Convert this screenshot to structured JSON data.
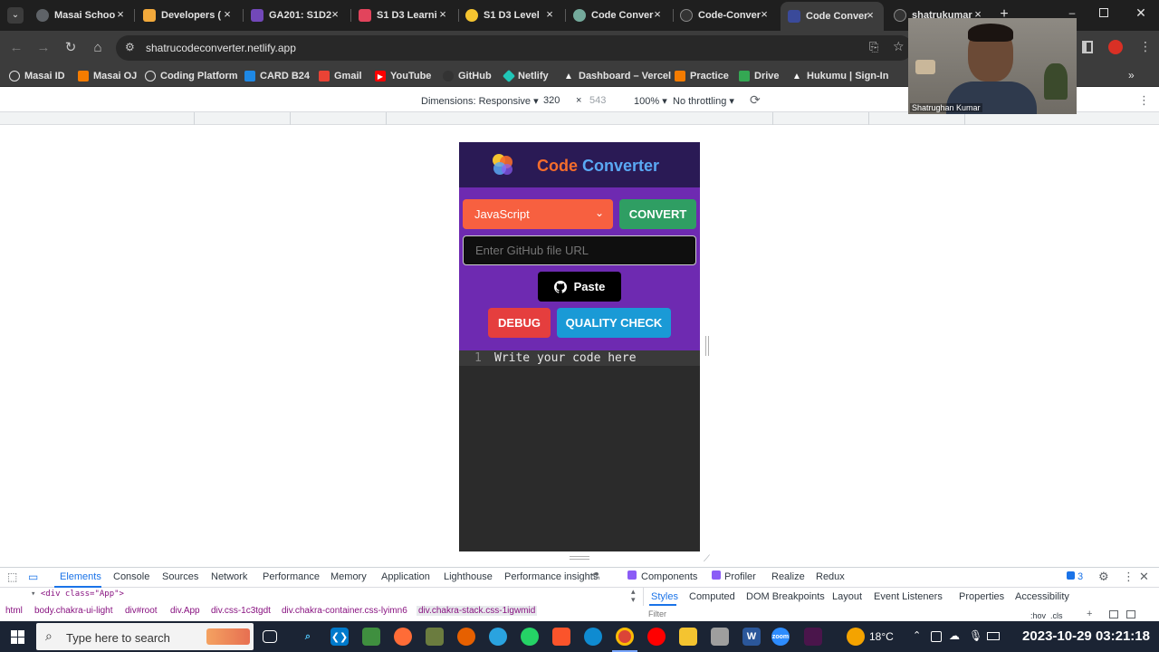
{
  "browser": {
    "tabs": [
      {
        "title": "Masai Schoo",
        "icon": "globe-icon",
        "color": "#5f6368"
      },
      {
        "title": "Developers (",
        "icon": "ruler-icon",
        "color": "#f2a93b"
      },
      {
        "title": "GA201: S1D2",
        "icon": "forms-icon",
        "color": "#7248b9"
      },
      {
        "title": "S1 D3 Learni",
        "icon": "home-icon",
        "color": "#e2445c"
      },
      {
        "title": "S1 D3 Level",
        "icon": "bulb-icon",
        "color": "#f4c430"
      },
      {
        "title": "Code Conver",
        "icon": "chatgpt-icon",
        "color": "#74aa9c"
      },
      {
        "title": "Code-Conver",
        "icon": "github-icon",
        "color": "#333333"
      },
      {
        "title": "Code Conver",
        "icon": "netlify-icon",
        "color": "#3a4a9a",
        "active": true
      },
      {
        "title": "shatrukumar",
        "icon": "github-icon",
        "color": "#333333"
      }
    ],
    "url": "shatrucodeconverter.netlify.app",
    "bookmarks": [
      {
        "label": "Masai ID",
        "color": "#ffffff"
      },
      {
        "label": "Masai OJ",
        "color": "#f57c00"
      },
      {
        "label": "Coding Platform",
        "color": "#ffffff"
      },
      {
        "label": "CARD B24",
        "color": "#1e88e5"
      },
      {
        "label": "Gmail",
        "color": "#ea4335"
      },
      {
        "label": "YouTube",
        "color": "#ff0000"
      },
      {
        "label": "GitHub",
        "color": "#333333"
      },
      {
        "label": "Netlify",
        "color": "#20c6b7"
      },
      {
        "label": "Dashboard – Vercel",
        "color": "#ffffff"
      },
      {
        "label": "Practice",
        "color": "#f57c00"
      },
      {
        "label": "Drive",
        "color": "#34a853"
      },
      {
        "label": "Hukumu | Sign-In",
        "color": "#ffffff"
      }
    ]
  },
  "device_toolbar": {
    "dimensions_label": "Dimensions: Responsive",
    "width": "320",
    "times": "×",
    "height": "543",
    "zoom": "100%",
    "throttling": "No throttling"
  },
  "app": {
    "title_part1": "Code",
    "title_part2": "Converter",
    "language": "JavaScript",
    "convert_label": "CONVERT",
    "url_placeholder": "Enter GitHub file URL",
    "paste_label": "Paste",
    "debug_label": "DEBUG",
    "quality_label": "QUALITY CHECK",
    "editor_line_number": "1",
    "editor_text": "Write your code here"
  },
  "webcam": {
    "name": "Shatrughan Kumar"
  },
  "devtools": {
    "tabs": [
      "Elements",
      "Console",
      "Sources",
      "Network",
      "Performance",
      "Memory",
      "Application",
      "Lighthouse",
      "Performance insights",
      "Components",
      "Profiler",
      "Realize",
      "Redux"
    ],
    "issues_count": "3",
    "dom_line": "<div class=\"App\">",
    "breadcrumbs": [
      "html",
      "body.chakra-ui-light",
      "div#root",
      "div.App",
      "div.css-1c3tgdt",
      "div.chakra-container.css-lyimn6",
      "div.chakra-stack.css-1igwmid"
    ],
    "side_tabs": [
      "Styles",
      "Computed",
      "DOM Breakpoints",
      "Layout",
      "Event Listeners",
      "Properties",
      "Accessibility"
    ],
    "filter_placeholder": "Filter",
    "hov_cls": ":hov  .cls"
  },
  "taskbar": {
    "search_placeholder": "Type here to search",
    "weather": "18°C",
    "datetime": "2023-10-29  03:21:18"
  }
}
